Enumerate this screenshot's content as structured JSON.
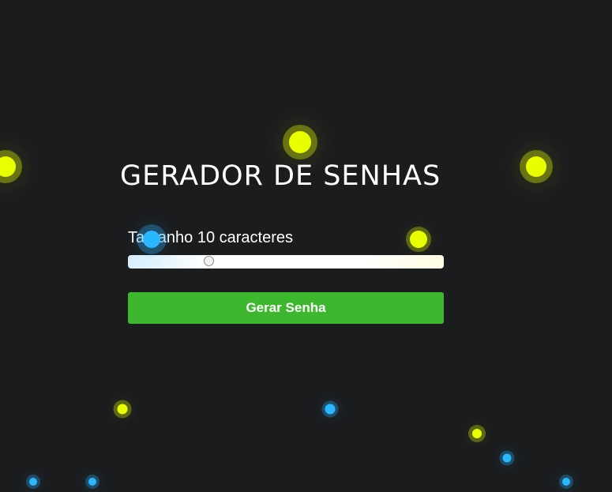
{
  "app": {
    "title": "GERADOR DE SENHAS"
  },
  "length": {
    "label": "Tamanho 10 caracteres",
    "value": 10
  },
  "button": {
    "label": "Gerar Senha"
  },
  "colors": {
    "background": "#1b1c1e",
    "accent_green": "#3db82e",
    "particle_yellow": "#e8ff00",
    "particle_blue": "#2bb7ff"
  }
}
